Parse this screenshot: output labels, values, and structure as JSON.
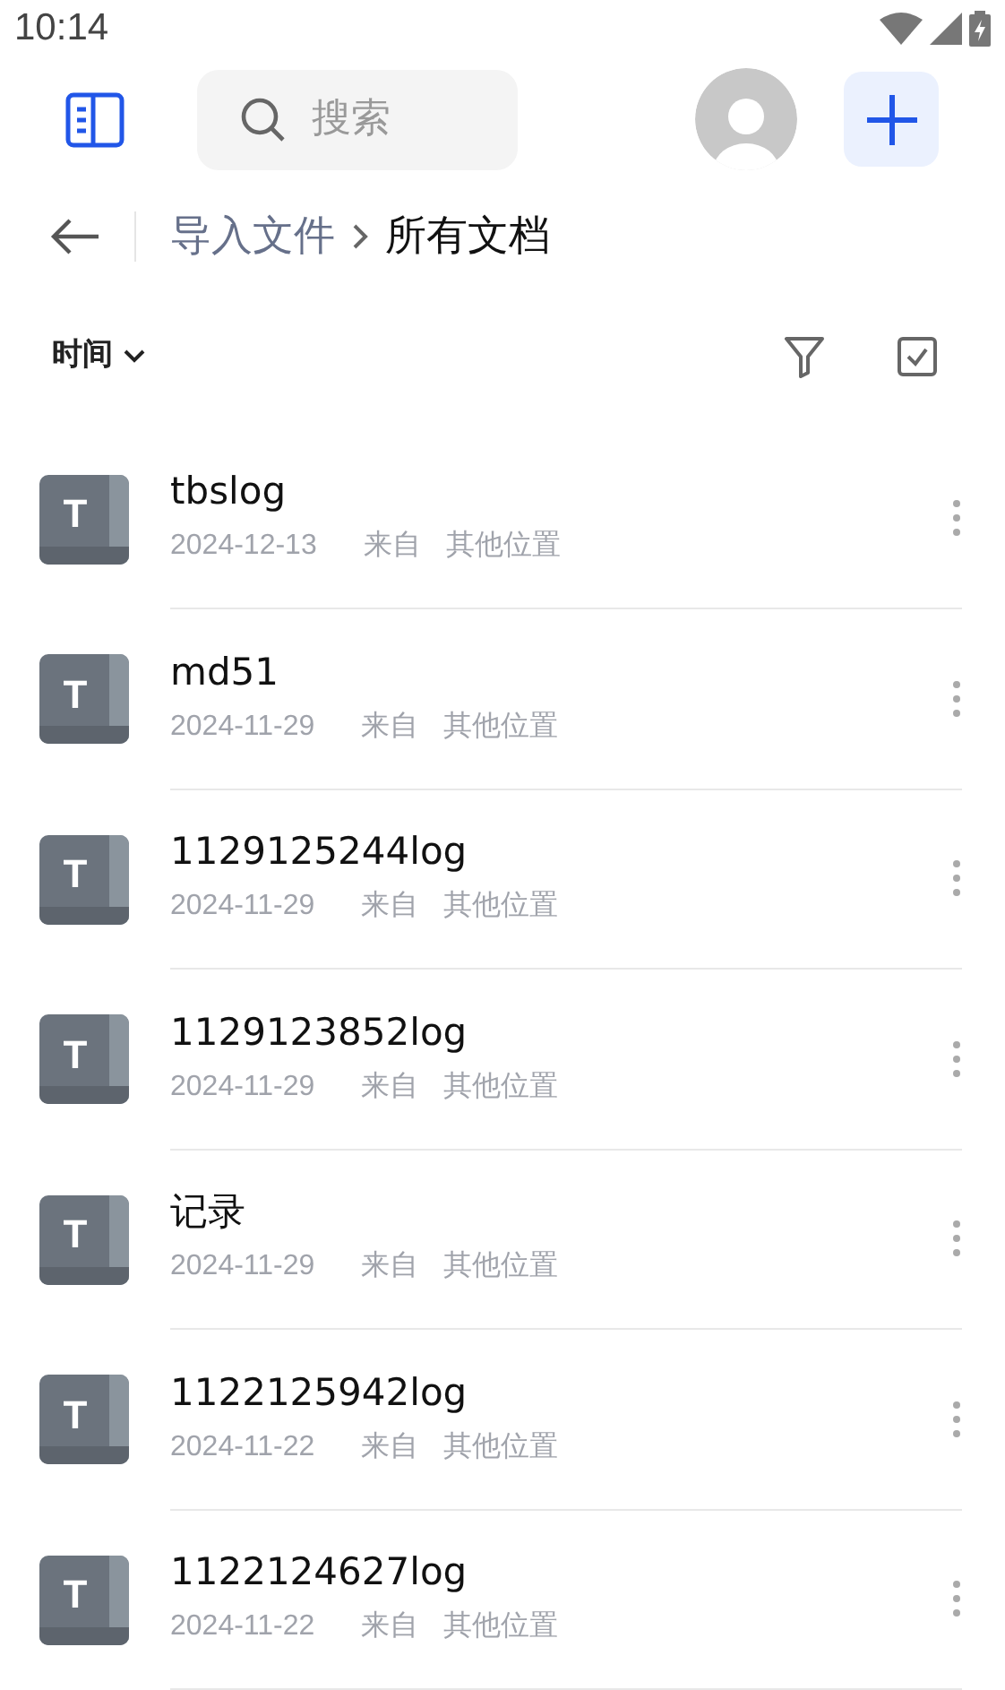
{
  "status_bar": {
    "time": "10:14"
  },
  "search": {
    "placeholder": "搜索"
  },
  "breadcrumb": [
    {
      "label": "导入文件",
      "current": false
    },
    {
      "label": "所有文档",
      "current": true
    }
  ],
  "sort": {
    "label": "时间"
  },
  "files": [
    {
      "icon_letter": "T",
      "name": "tbslog",
      "date": "2024-12-13",
      "from": "来自",
      "source": "其他位置"
    },
    {
      "icon_letter": "T",
      "name": "md51",
      "date": "2024-11-29",
      "from": "来自",
      "source": "其他位置"
    },
    {
      "icon_letter": "T",
      "name": "1129125244log",
      "date": "2024-11-29",
      "from": "来自",
      "source": "其他位置"
    },
    {
      "icon_letter": "T",
      "name": "1129123852log",
      "date": "2024-11-29",
      "from": "来自",
      "source": "其他位置"
    },
    {
      "icon_letter": "T",
      "name": "记录",
      "date": "2024-11-29",
      "from": "来自",
      "source": "其他位置"
    },
    {
      "icon_letter": "T",
      "name": "1122125942log",
      "date": "2024-11-22",
      "from": "来自",
      "source": "其他位置"
    },
    {
      "icon_letter": "T",
      "name": "1122124627log",
      "date": "2024-11-22",
      "from": "来自",
      "source": "其他位置"
    }
  ]
}
